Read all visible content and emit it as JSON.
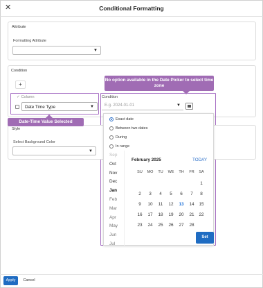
{
  "dialog": {
    "title": "Conditional Formatting",
    "close_glyph": "✕"
  },
  "attribute": {
    "section_title": "Attribute",
    "field_label": "Formatting Attribute",
    "value": ""
  },
  "condition": {
    "section_title": "Condition",
    "add_glyph": "+",
    "column_label": "Column",
    "column_check": "✓",
    "column_value": "Date Time Type",
    "condition_label": "Condition",
    "condition_placeholder": "E.g. 2024-01-01"
  },
  "style": {
    "section_title": "Style",
    "bg_color_label": "Select Background Color",
    "bg_color_value": ""
  },
  "annotations": {
    "datepicker_note": "No option available in the Date Picker to select time zone",
    "column_note": "Date-Time Value Selected",
    "accent_color": "#a06cb4"
  },
  "datepicker": {
    "options": [
      {
        "label": "Exact date",
        "selected": true
      },
      {
        "label": "Between two dates",
        "selected": false
      },
      {
        "label": "During",
        "selected": false
      },
      {
        "label": "In range",
        "selected": false
      }
    ],
    "months": [
      "Sep",
      "Oct",
      "Nov",
      "Dec",
      "Jan",
      "Feb",
      "Mar",
      "Apr",
      "May",
      "Jun",
      "Jul"
    ],
    "selected_month": "Jan",
    "title": "February 2025",
    "today_label": "TODAY",
    "weekdays": [
      "SU",
      "MO",
      "TU",
      "WE",
      "TH",
      "FR",
      "SA"
    ],
    "weeks": [
      [
        "",
        "",
        "",
        "",
        "",
        "",
        "1"
      ],
      [
        "2",
        "3",
        "4",
        "5",
        "6",
        "7",
        "8"
      ],
      [
        "9",
        "10",
        "11",
        "12",
        "13",
        "14",
        "15"
      ],
      [
        "16",
        "17",
        "18",
        "19",
        "20",
        "21",
        "22"
      ],
      [
        "23",
        "24",
        "25",
        "26",
        "27",
        "28",
        ""
      ]
    ],
    "highlighted_day": "13",
    "set_label": "Set"
  },
  "footer": {
    "apply_label": "Apply",
    "cancel_label": "Cancel"
  },
  "colors": {
    "primary": "#1f6cc2",
    "annotation": "#a06cb4",
    "today": "#1a6fd8"
  }
}
